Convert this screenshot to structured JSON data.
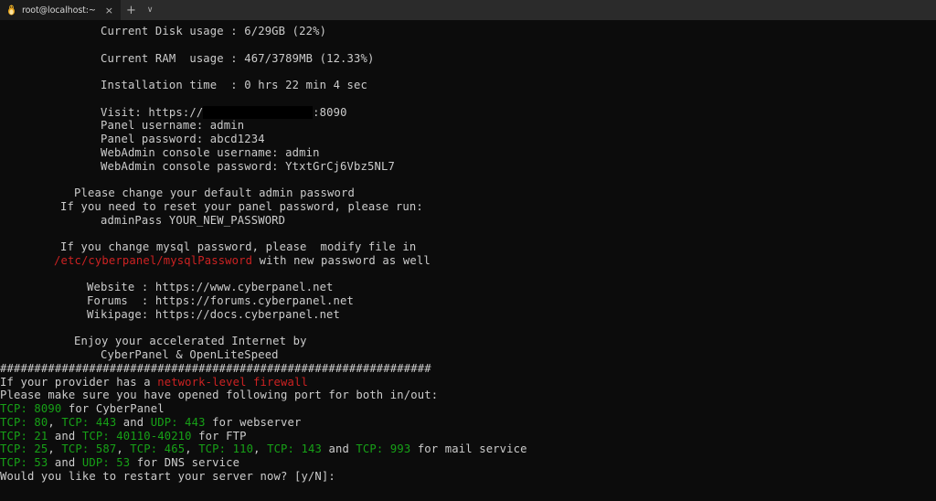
{
  "window": {
    "tab": {
      "title": "root@localhost:~",
      "icon": "tux-penguin-icon",
      "close_label": "×"
    },
    "new_tab_label": "+",
    "tab_menu_label": "∨"
  },
  "terminal": {
    "colors": {
      "background": "#0c0c0c",
      "foreground": "#cccccc",
      "green": "#17a117",
      "red": "#cc2222"
    },
    "lines": [
      {
        "indent": 110,
        "segments": [
          {
            "text": "Current Disk usage : 6/29GB (22%)"
          }
        ]
      },
      {
        "indent": 0,
        "segments": []
      },
      {
        "indent": 110,
        "segments": [
          {
            "text": "Current RAM  usage : 467/3789MB (12.33%)"
          }
        ]
      },
      {
        "indent": 0,
        "segments": []
      },
      {
        "indent": 110,
        "segments": [
          {
            "text": "Installation time  : 0 hrs 22 min 4 sec"
          }
        ]
      },
      {
        "indent": 0,
        "segments": []
      },
      {
        "indent": 110,
        "segments": [
          {
            "text": "Visit: https://"
          },
          {
            "text": "                ",
            "style": "redact"
          },
          {
            "text": ":8090"
          }
        ]
      },
      {
        "indent": 110,
        "segments": [
          {
            "text": "Panel username: admin"
          }
        ]
      },
      {
        "indent": 110,
        "segments": [
          {
            "text": "Panel password: abcd1234"
          }
        ]
      },
      {
        "indent": 110,
        "segments": [
          {
            "text": "WebAdmin console username: admin"
          }
        ]
      },
      {
        "indent": 110,
        "segments": [
          {
            "text": "WebAdmin console password: YtxtGrCj6Vbz5NL7"
          }
        ]
      },
      {
        "indent": 0,
        "segments": []
      },
      {
        "indent": 81,
        "segments": [
          {
            "text": "Please change your default admin password"
          }
        ]
      },
      {
        "indent": 66,
        "segments": [
          {
            "text": "If you need to reset your panel password, please run:"
          }
        ]
      },
      {
        "indent": 110,
        "segments": [
          {
            "text": "adminPass YOUR_NEW_PASSWORD"
          }
        ]
      },
      {
        "indent": 0,
        "segments": []
      },
      {
        "indent": 66,
        "segments": [
          {
            "text": "If you change mysql password, please  modify file in"
          }
        ]
      },
      {
        "indent": 59,
        "segments": [
          {
            "text": "/etc/cyberpanel/mysqlPassword",
            "style": "red"
          },
          {
            "text": " with new password as well"
          }
        ]
      },
      {
        "indent": 0,
        "segments": []
      },
      {
        "indent": 95,
        "segments": [
          {
            "text": "Website : https://www.cyberpanel.net"
          }
        ]
      },
      {
        "indent": 95,
        "segments": [
          {
            "text": "Forums  : https://forums.cyberpanel.net"
          }
        ]
      },
      {
        "indent": 95,
        "segments": [
          {
            "text": "Wikipage: https://docs.cyberpanel.net"
          }
        ]
      },
      {
        "indent": 0,
        "segments": []
      },
      {
        "indent": 81,
        "segments": [
          {
            "text": "Enjoy your accelerated Internet by"
          }
        ]
      },
      {
        "indent": 110,
        "segments": [
          {
            "text": "CyberPanel & OpenLiteSpeed"
          }
        ]
      },
      {
        "indent": 0,
        "segments": [
          {
            "text": "###############################################################"
          }
        ]
      },
      {
        "indent": 0,
        "segments": [
          {
            "text": "If your provider has a "
          },
          {
            "text": "network-level firewall",
            "style": "red"
          }
        ]
      },
      {
        "indent": 0,
        "segments": [
          {
            "text": "Please make sure you have opened following port for both in/out:"
          }
        ]
      },
      {
        "indent": 0,
        "segments": [
          {
            "text": "TCP: 8090",
            "style": "green"
          },
          {
            "text": " for CyberPanel"
          }
        ]
      },
      {
        "indent": 0,
        "segments": [
          {
            "text": "TCP: 80",
            "style": "green"
          },
          {
            "text": ", "
          },
          {
            "text": "TCP: 443",
            "style": "green"
          },
          {
            "text": " and "
          },
          {
            "text": "UDP: 443",
            "style": "green"
          },
          {
            "text": " for webserver"
          }
        ]
      },
      {
        "indent": 0,
        "segments": [
          {
            "text": "TCP: 21",
            "style": "green"
          },
          {
            "text": " and "
          },
          {
            "text": "TCP: 40110-40210",
            "style": "green"
          },
          {
            "text": " for FTP"
          }
        ]
      },
      {
        "indent": 0,
        "segments": [
          {
            "text": "TCP: 25",
            "style": "green"
          },
          {
            "text": ", "
          },
          {
            "text": "TCP: 587",
            "style": "green"
          },
          {
            "text": ", "
          },
          {
            "text": "TCP: 465",
            "style": "green"
          },
          {
            "text": ", "
          },
          {
            "text": "TCP: 110",
            "style": "green"
          },
          {
            "text": ", "
          },
          {
            "text": "TCP: 143",
            "style": "green"
          },
          {
            "text": " and "
          },
          {
            "text": "TCP: 993",
            "style": "green"
          },
          {
            "text": " for mail service"
          }
        ]
      },
      {
        "indent": 0,
        "segments": [
          {
            "text": "TCP: 53",
            "style": "green"
          },
          {
            "text": " and "
          },
          {
            "text": "UDP: 53",
            "style": "green"
          },
          {
            "text": " for DNS service"
          }
        ]
      },
      {
        "indent": 0,
        "segments": [
          {
            "text": "Would you like to restart your server now? [y/N]: "
          }
        ]
      }
    ]
  }
}
